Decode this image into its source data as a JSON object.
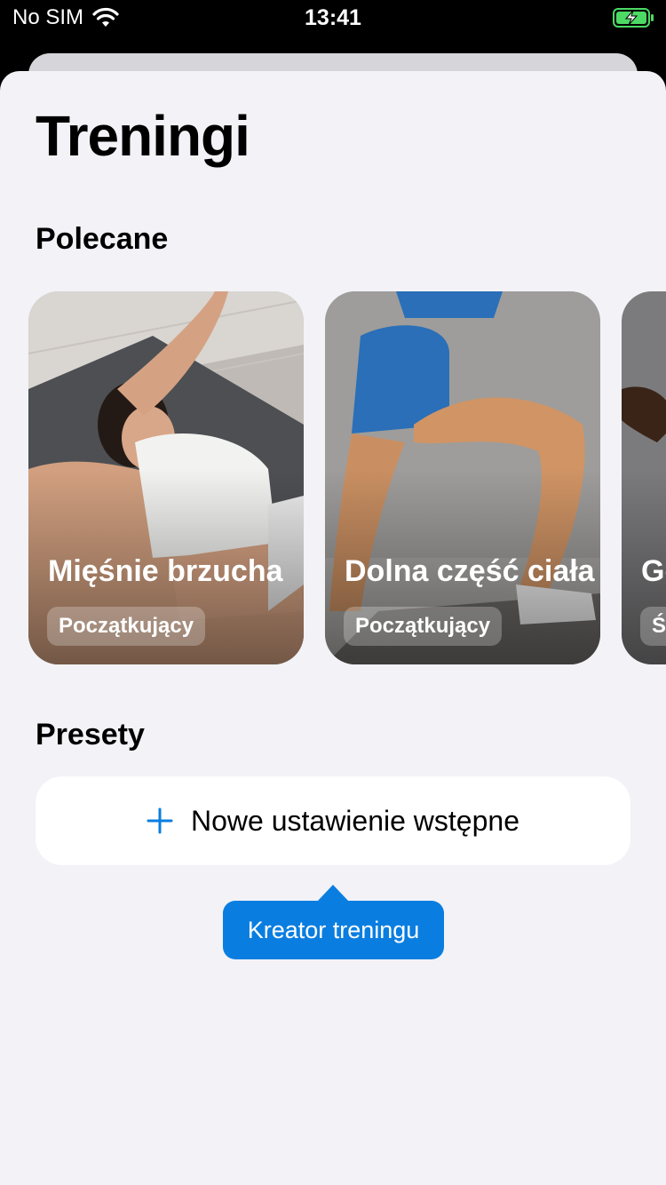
{
  "status_bar": {
    "carrier": "No SIM",
    "time": "13:41",
    "icons": [
      "wifi-icon",
      "battery-charging-icon"
    ]
  },
  "page": {
    "title": "Treningi"
  },
  "featured": {
    "heading": "Polecane",
    "cards": [
      {
        "name": "Mięśnie brzucha",
        "level": "Początkujący"
      },
      {
        "name": "Dolna część ciała",
        "level": "Początkujący"
      },
      {
        "name": "Gó",
        "level": "Ś"
      }
    ]
  },
  "presets": {
    "heading": "Presety",
    "add_label": "Nowe ustawienie wstępne",
    "add_icon": "plus-icon"
  },
  "tooltip": {
    "text": "Kreator treningu"
  },
  "colors": {
    "accent": "#0a7ee0",
    "background": "#f2f2f7",
    "battery": "#4cd964"
  }
}
